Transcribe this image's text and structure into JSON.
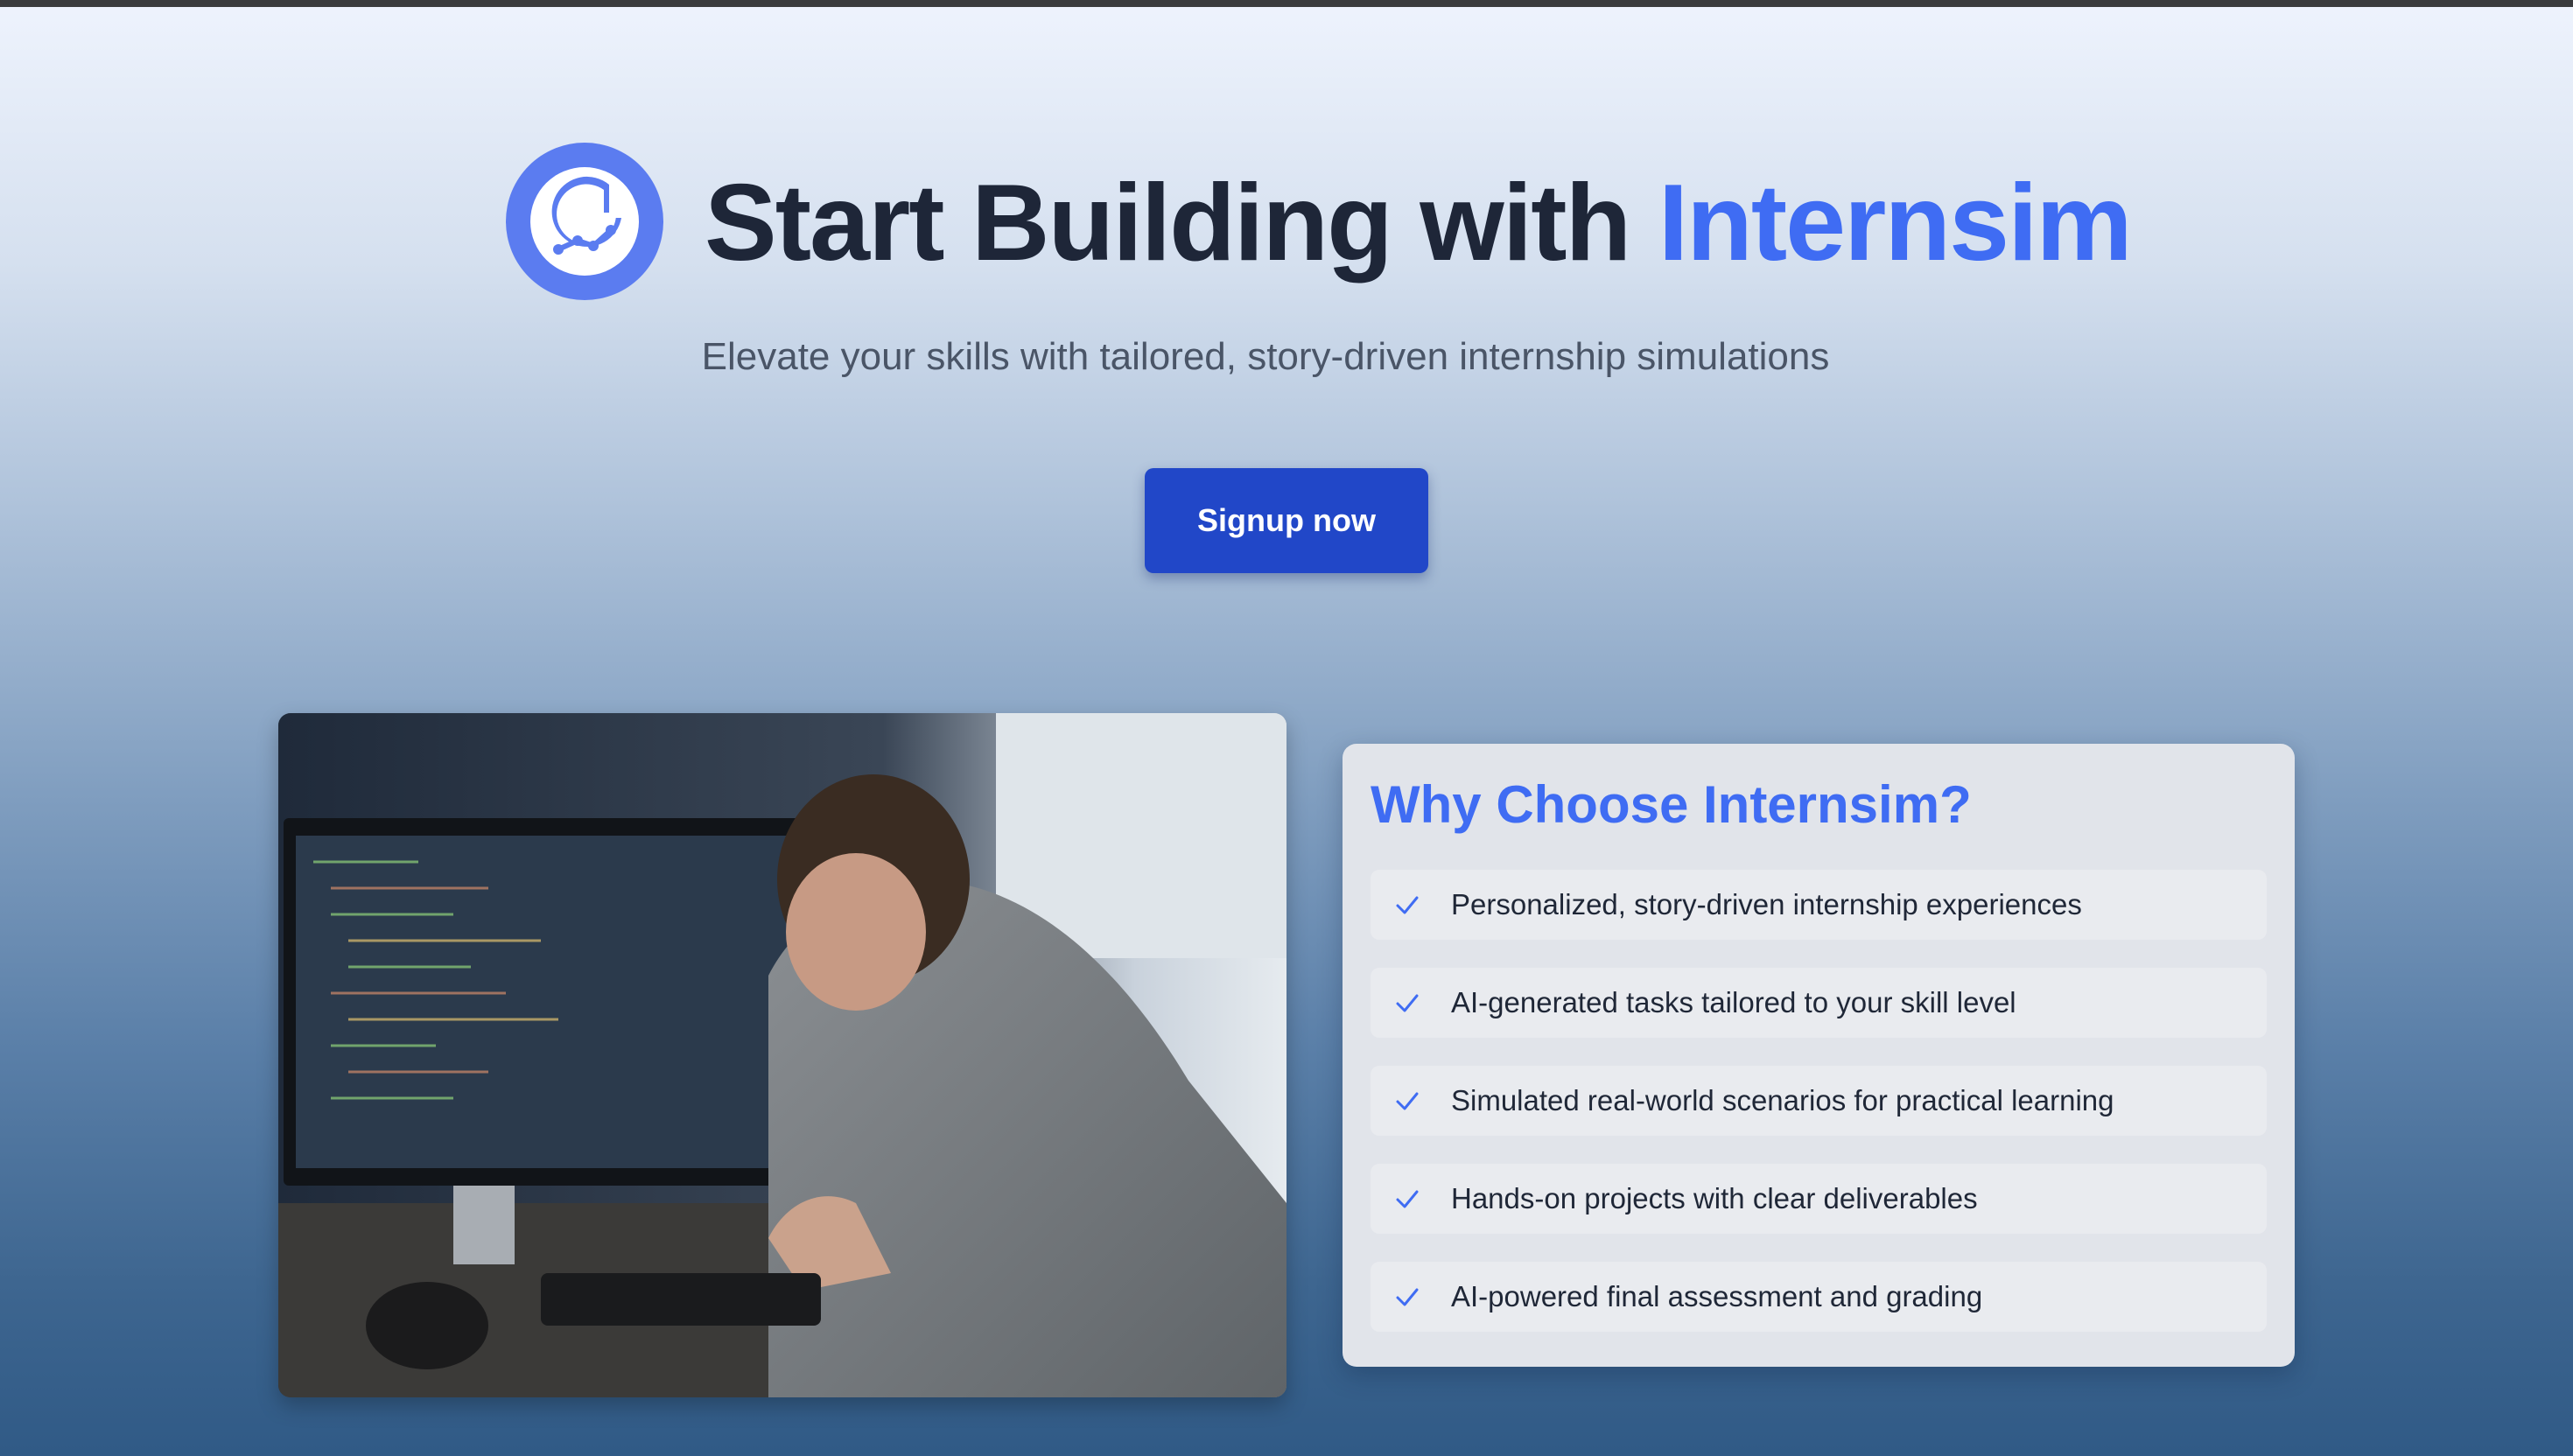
{
  "hero": {
    "title_prefix": "Start Building with ",
    "title_brand": "Internsim",
    "subtitle": "Elevate your skills with tailored, story-driven internship simulations",
    "cta_label": "Signup now",
    "logo_icon": "internsim-logo-icon"
  },
  "features": {
    "heading": "Why Choose Internsim?",
    "items": [
      {
        "icon": "check-icon",
        "label": "Personalized, story-driven internship experiences"
      },
      {
        "icon": "check-icon",
        "label": "AI-generated tasks tailored to your skill level"
      },
      {
        "icon": "check-icon",
        "label": "Simulated real-world scenarios for practical learning"
      },
      {
        "icon": "check-icon",
        "label": "Hands-on projects with clear deliverables"
      },
      {
        "icon": "check-icon",
        "label": "AI-powered final assessment and grading"
      }
    ]
  },
  "colors": {
    "brand": "#3f6cf3",
    "cta": "#2147c8",
    "logo_bg": "#5b7cf0"
  }
}
